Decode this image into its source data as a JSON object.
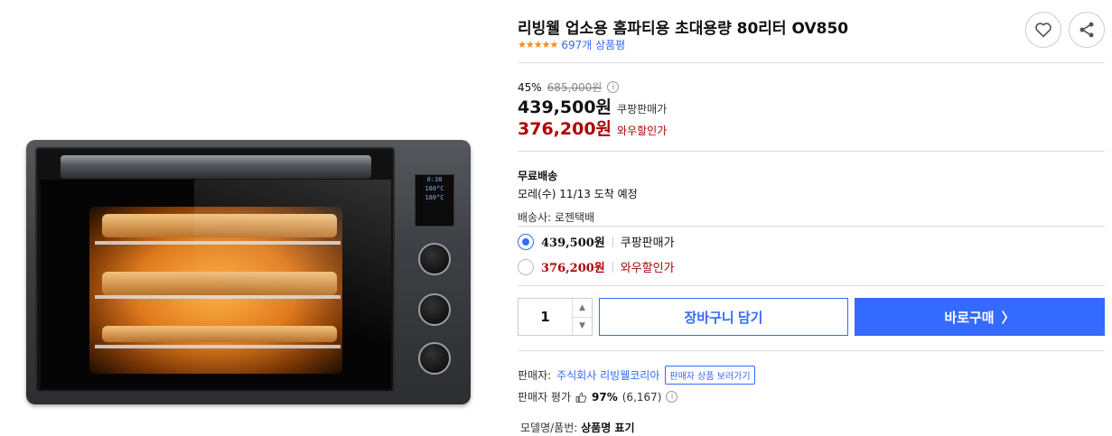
{
  "product": {
    "title": "리빙웰 업소용 홈파티용 초대용량 80리터 OV850",
    "stars": "★★★★★",
    "review_count": "697개 상품평",
    "rating_value": 5
  },
  "actions": {
    "wishlist_icon": "heart-icon",
    "share_icon": "share-icon"
  },
  "price": {
    "discount": "45%",
    "original": "685,000원",
    "coupang_price": "439,500원",
    "coupang_label": "쿠팡판매가",
    "wow_price": "376,200원",
    "wow_label": "와우할인가"
  },
  "shipping": {
    "title": "무료배송",
    "date": "모레(수) 11/13 도착 예정",
    "carrier": "배송사: 로젠택배"
  },
  "options": [
    {
      "price": "439,500원",
      "label": "쿠팡판매가",
      "selected": true
    },
    {
      "price": "376,200원",
      "label": "와우할인가",
      "selected": false
    }
  ],
  "purchase": {
    "quantity": "1",
    "cart_label": "장바구니 담기",
    "buy_label": "바로구매",
    "buy_arrow": "〉"
  },
  "seller": {
    "prefix": "판매자:",
    "name": "주식회사 리빙웰코리아",
    "view_products": "판매자 상품 보러가기",
    "rating_prefix": "판매자 평가",
    "rating_percent": "97%",
    "rating_count": "(6,167)"
  },
  "model": {
    "prefix": "모델명/품번:",
    "value": "상품명 표기"
  },
  "oven_display": {
    "line1": "0:38",
    "line2": "180°C",
    "line3": "180°C"
  },
  "colors": {
    "accent": "#346aff",
    "wow_red": "#ae0000",
    "star": "#f68b1e"
  }
}
